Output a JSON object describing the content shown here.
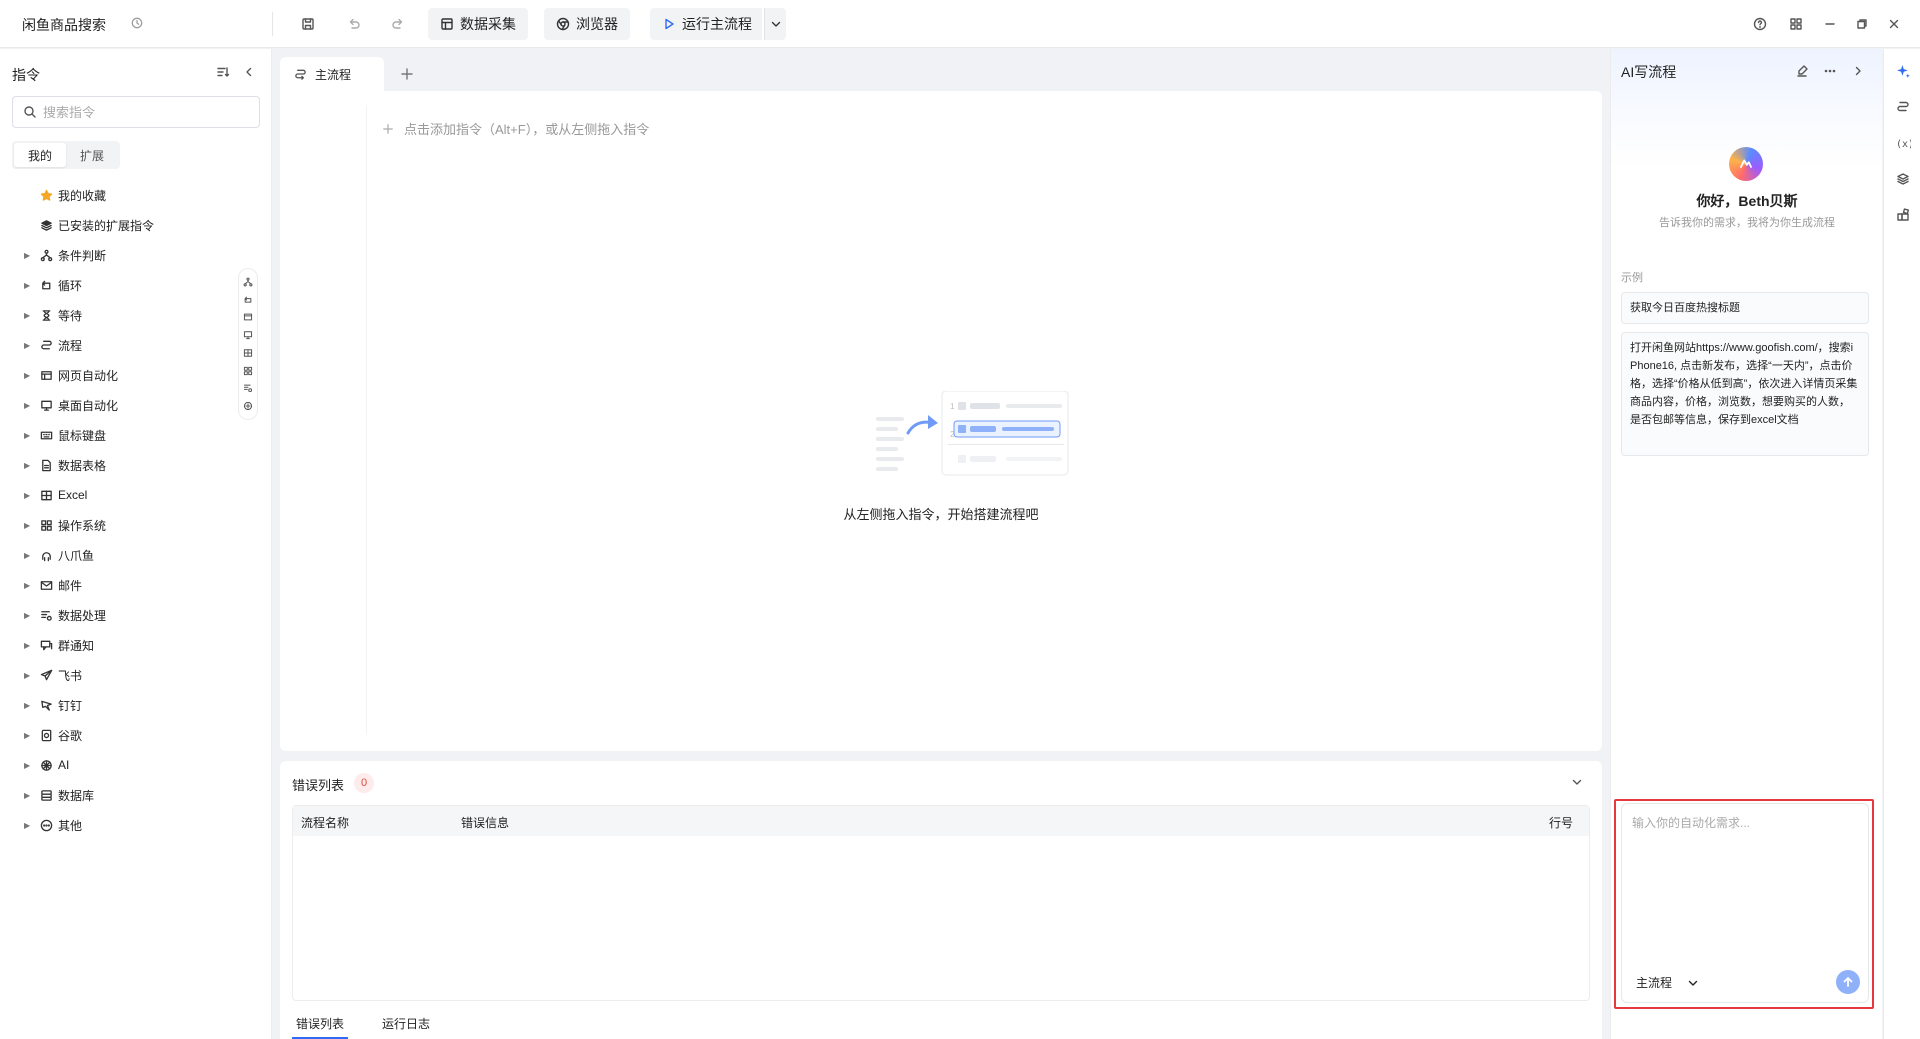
{
  "app": {
    "title": "闲鱼商品搜索"
  },
  "toolbar": {
    "data_capture_label": "数据采集",
    "browser_label": "浏览器",
    "run_label": "运行主流程"
  },
  "left_panel": {
    "title": "指令",
    "search_placeholder": "搜索指令",
    "tabs": [
      "我的",
      "扩展"
    ],
    "active_tab": "我的",
    "items": [
      {
        "label": "我的收藏",
        "icon": "star-icon",
        "expandable": false
      },
      {
        "label": "已安装的扩展指令",
        "icon": "extension-stack-icon",
        "expandable": false
      },
      {
        "label": "条件判断",
        "icon": "branch-icon",
        "expandable": true
      },
      {
        "label": "循环",
        "icon": "loop-icon",
        "expandable": true
      },
      {
        "label": "等待",
        "icon": "hourglass-icon",
        "expandable": true
      },
      {
        "label": "流程",
        "icon": "flow-icon",
        "expandable": true
      },
      {
        "label": "网页自动化",
        "icon": "browser-window-icon",
        "expandable": true
      },
      {
        "label": "桌面自动化",
        "icon": "desktop-icon",
        "expandable": true
      },
      {
        "label": "鼠标键盘",
        "icon": "keyboard-icon",
        "expandable": true
      },
      {
        "label": "数据表格",
        "icon": "document-icon",
        "expandable": true
      },
      {
        "label": "Excel",
        "icon": "excel-icon",
        "expandable": true
      },
      {
        "label": "操作系统",
        "icon": "grid-icon",
        "expandable": true
      },
      {
        "label": "八爪鱼",
        "icon": "octopus-icon",
        "expandable": true
      },
      {
        "label": "邮件",
        "icon": "mail-icon",
        "expandable": true
      },
      {
        "label": "数据处理",
        "icon": "data-process-icon",
        "expandable": true
      },
      {
        "label": "群通知",
        "icon": "group-notify-icon",
        "expandable": true
      },
      {
        "label": "飞书",
        "icon": "paper-plane-icon",
        "expandable": true
      },
      {
        "label": "钉钉",
        "icon": "dingtalk-icon",
        "expandable": true
      },
      {
        "label": "谷歌",
        "icon": "google-icon",
        "expandable": true
      },
      {
        "label": "AI",
        "icon": "ai-icon",
        "expandable": true
      },
      {
        "label": "数据库",
        "icon": "database-icon",
        "expandable": true
      },
      {
        "label": "其他",
        "icon": "more-circle-icon",
        "expandable": true
      }
    ]
  },
  "editor": {
    "tab_label": "主流程",
    "add_hint": "点击添加指令（Alt+F），或从左侧拖入指令",
    "empty_text": "从左侧拖入指令，开始搭建流程吧"
  },
  "error_panel": {
    "title": "错误列表",
    "count": "0",
    "columns": [
      "流程名称",
      "错误信息",
      "行号"
    ],
    "rows": [],
    "bottom_tabs": [
      "错误列表",
      "运行日志"
    ],
    "active_bottom_tab": "错误列表"
  },
  "ai_panel": {
    "title": "AI写流程",
    "greeting": "你好，Beth贝斯",
    "subtitle": "告诉我你的需求，我将为你生成流程",
    "example_label": "示例",
    "examples": [
      "获取今日百度热搜标题",
      "打开闲鱼网站https://www.goofish.com/，搜索iPhone16, 点击新发布，选择“一天内”，点击价格，选择“价格从低到高”，依次进入详情页采集商品内容，价格，浏览数，想要购买的人数，是否包邮等信息，保存到excel文档"
    ],
    "input_placeholder": "输入你的自动化需求...",
    "flow_select": "主流程"
  },
  "colors": {
    "accent": "#2f6cf6",
    "highlight": "#e6393f",
    "error_badge": "#e0493c"
  }
}
